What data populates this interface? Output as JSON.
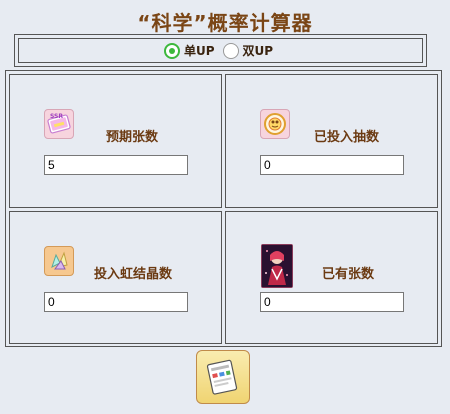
{
  "title": "“科学”概率计算器",
  "mode": {
    "options": [
      {
        "label": "单UP",
        "selected": true
      },
      {
        "label": "双UP",
        "selected": false
      }
    ]
  },
  "fields": {
    "expected_cards": {
      "label": "预期张数",
      "value": "5",
      "icon": "ssr-card-icon"
    },
    "draws_invested": {
      "label": "已投入抽数",
      "value": "0",
      "icon": "draw-ticket-icon"
    },
    "crystals_invested": {
      "label": "投入虹结晶数",
      "value": "0",
      "icon": "rainbow-crystal-icon"
    },
    "owned_cards": {
      "label": "已有张数",
      "value": "0",
      "icon": "character-card-icon"
    }
  },
  "colors": {
    "accent_green": "#3cb83c",
    "title_brown": "#7a4515",
    "label_brown": "#6b3a12"
  }
}
